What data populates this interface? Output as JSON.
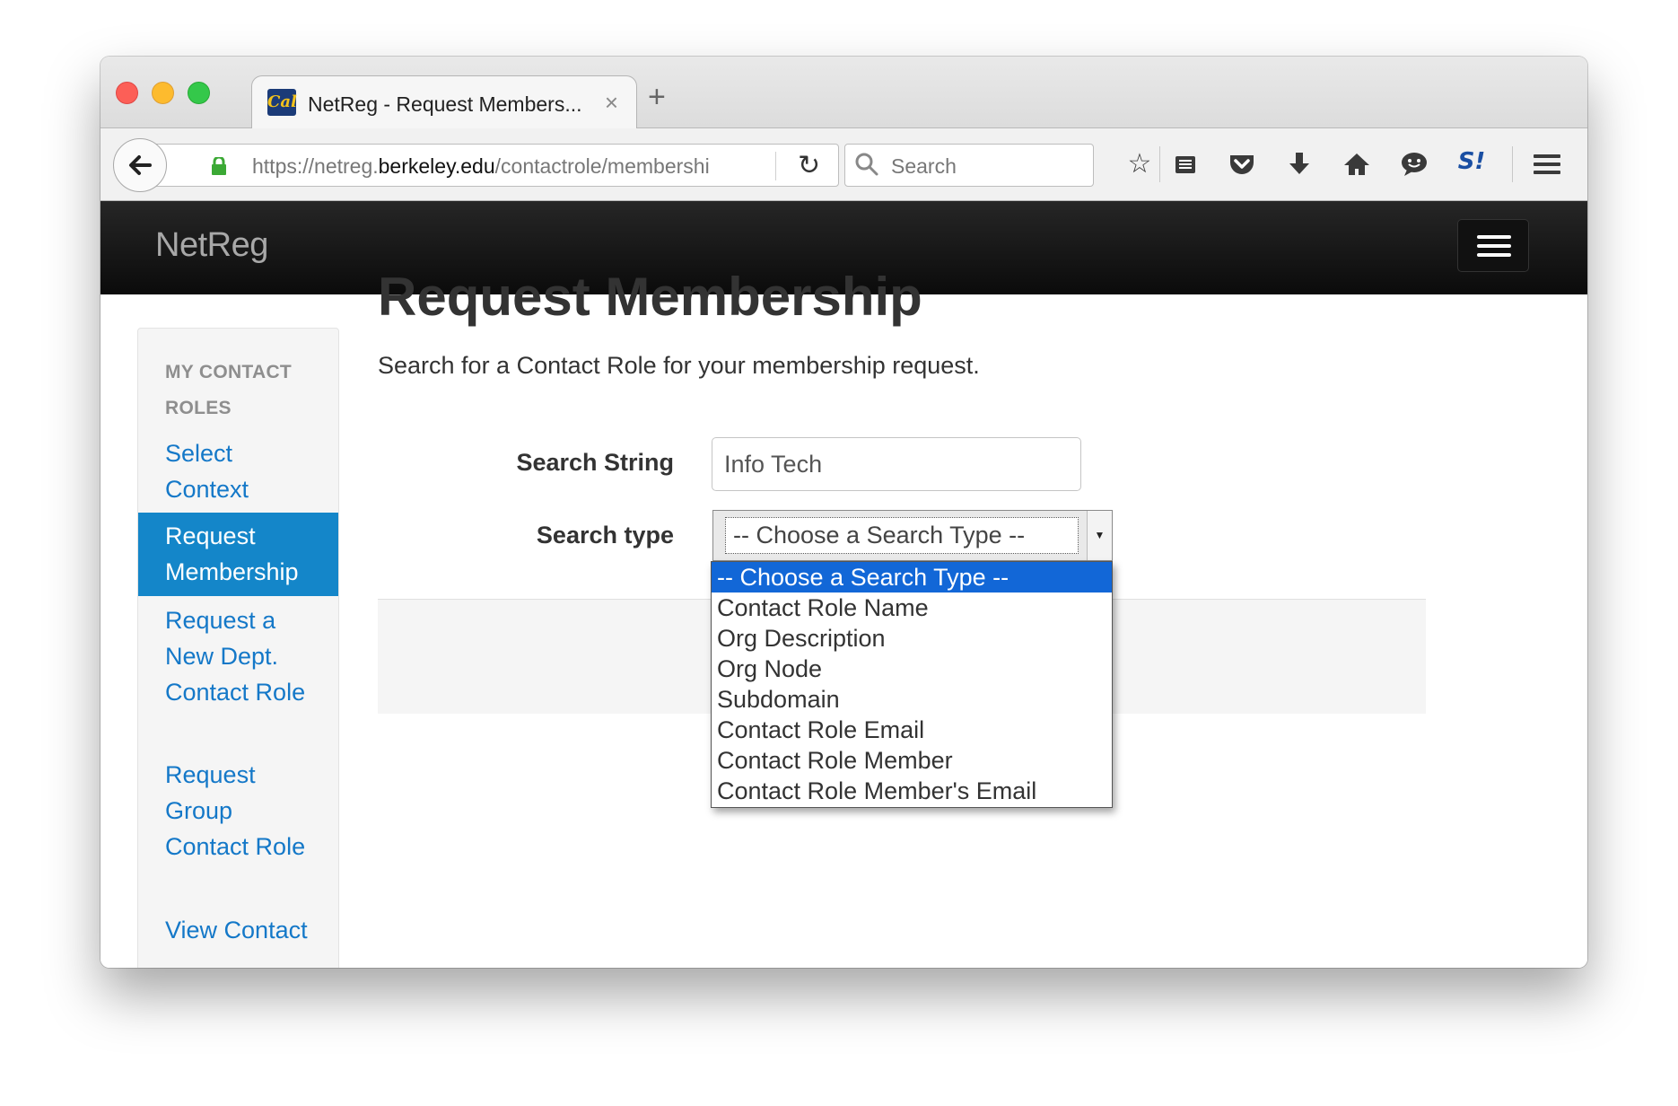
{
  "browser": {
    "tab_title": "NetReg - Request Members...",
    "tab_close": "×",
    "new_tab": "+",
    "url_prefix": "https://netreg.",
    "url_host": "berkeley.edu",
    "url_path": "/contactrole/membershi",
    "search_placeholder": "Search",
    "favicon_text": "Cal",
    "toolbar_icons": [
      "bookmark-star-icon",
      "reading-list-icon",
      "pocket-icon",
      "download-icon",
      "home-icon",
      "chat-icon",
      "extension-icon",
      "menu-icon"
    ],
    "extension_label": "S!"
  },
  "app": {
    "brand": "NetReg"
  },
  "sidebar": {
    "header": "MY CONTACT ROLES",
    "items": [
      {
        "label": "Select Context",
        "active": false
      },
      {
        "label": "Request Membership",
        "active": true
      },
      {
        "label": "Request a New Dept. Contact Role",
        "active": false
      },
      {
        "label": "Request Group Contact Role",
        "active": false
      },
      {
        "label": "View Contact",
        "active": false
      }
    ]
  },
  "main": {
    "title": "Request Membership",
    "description": "Search for a Contact Role for your membership request.",
    "search_string_label": "Search String",
    "search_string_value": "Info Tech",
    "search_type_label": "Search type",
    "search_type_selected": "-- Choose a Search Type --",
    "search_type_options": [
      "-- Choose a Search Type --",
      "Contact Role Name",
      "Org Description",
      "Org Node",
      "Subdomain",
      "Contact Role Email",
      "Contact Role Member",
      "Contact Role Member's Email"
    ]
  }
}
